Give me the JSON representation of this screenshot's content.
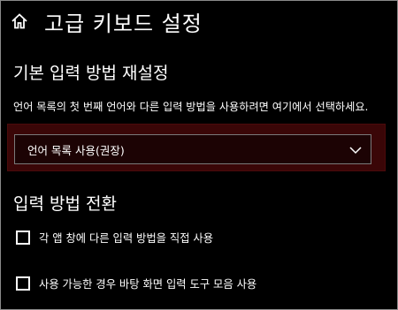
{
  "header": {
    "icon": "home-icon",
    "title": "고급 키보드 설정"
  },
  "sections": [
    {
      "title": "기본 입력 방법 재설정",
      "description": "언어 목록의 첫 번째 언어와 다른 입력 방법을 사용하려면 여기에서 선택하세요.",
      "dropdown": {
        "selected": "언어 목록 사용(권장)",
        "icon": "chevron-down-icon"
      }
    },
    {
      "title": "입력 방법 전환",
      "checkboxes": [
        {
          "label": "각 앱 창에 다른 입력 방법을 직접 사용",
          "checked": false
        },
        {
          "label": "사용 가능한 경우 바탕 화면 입력 도구 모음 사용",
          "checked": false
        }
      ]
    }
  ],
  "colors": {
    "background": "#000000",
    "text": "#ffffff",
    "focus_highlight": "#3a0607"
  }
}
